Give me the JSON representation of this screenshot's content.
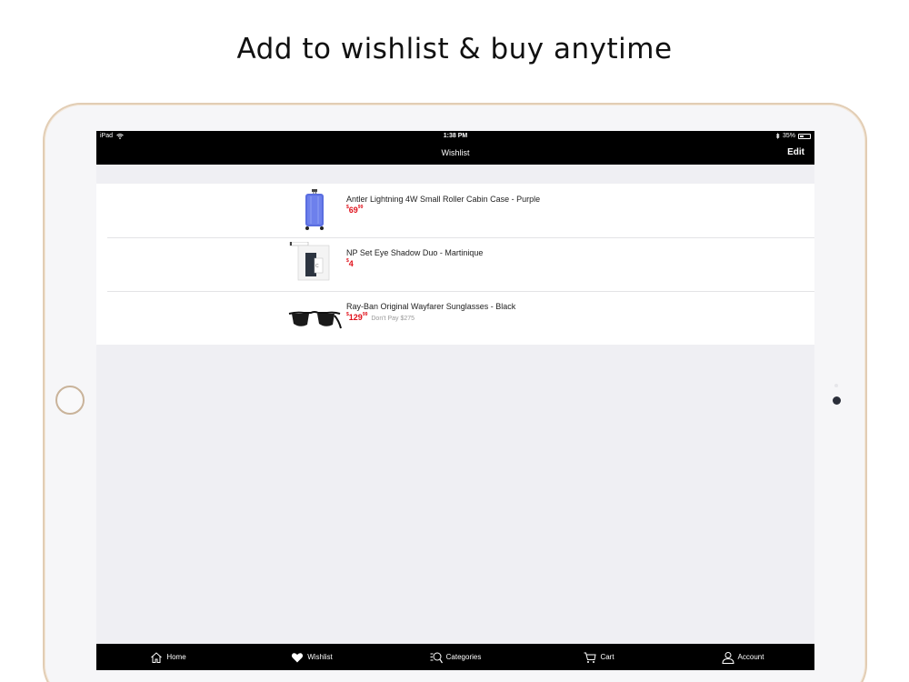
{
  "headline": "Add to wishlist & buy anytime",
  "statusbar": {
    "device": "iPad",
    "time": "1:38 PM",
    "battery": "35%"
  },
  "navbar": {
    "title": "Wishlist",
    "edit_label": "Edit"
  },
  "wishlist": [
    {
      "name": "Antler Lightning 4W Small Roller Cabin Case - Purple",
      "price_main": "69",
      "price_cents": "99",
      "price_currency": "$",
      "was": ""
    },
    {
      "name": "NP Set Eye Shadow Duo - Martinique",
      "price_main": "4",
      "price_cents": "",
      "price_currency": "$",
      "was": ""
    },
    {
      "name": "Ray-Ban Original Wayfarer Sunglasses - Black",
      "price_main": "129",
      "price_cents": "99",
      "price_currency": "$",
      "was": "Don't Pay $275"
    }
  ],
  "tabbar": {
    "home": "Home",
    "wishlist": "Wishlist",
    "categories": "Categories",
    "cart": "Cart",
    "account": "Account"
  },
  "icons": {
    "wifi": "wifi-icon",
    "bluetooth": "bluetooth-icon",
    "battery": "battery-icon",
    "home": "house-icon",
    "wishlist": "heart-icon",
    "categories": "list-search-icon",
    "cart": "cart-icon",
    "account": "person-icon"
  },
  "colors": {
    "price": "#e0101a",
    "bar": "#000000",
    "device_frame": "#e2cdb4",
    "list_bg": "#ffffff",
    "screen_bg": "#efeff3"
  }
}
